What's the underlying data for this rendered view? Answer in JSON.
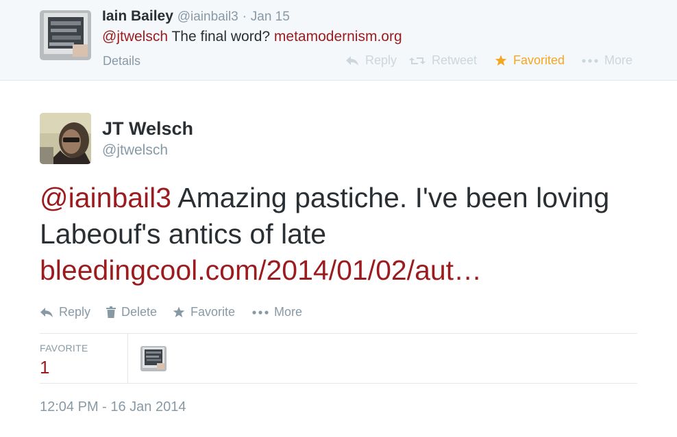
{
  "parent_tweet": {
    "name": "Iain Bailey",
    "handle": "@iainbail3",
    "separator": "·",
    "date": "Jan 15",
    "mention": "@jtwelsch",
    "text": "The final word?",
    "link": "metamodernism.org",
    "details_label": "Details",
    "actions": {
      "reply": "Reply",
      "retweet": "Retweet",
      "favorited": "Favorited",
      "more": "More"
    }
  },
  "tweet": {
    "author_name": "JT Welsch",
    "author_handle": "@jtwelsch",
    "mention": "@iainbail3",
    "text": "Amazing pastiche. I've been loving Labeouf's antics of late",
    "link": "bleedingcool.com/2014/01/02/aut…",
    "actions": {
      "reply": "Reply",
      "delete": "Delete",
      "favorite": "Favorite",
      "more": "More"
    },
    "stats": {
      "favorite_label": "FAVORITE",
      "favorite_count": "1"
    },
    "timestamp": "12:04 PM - 16 Jan 2014"
  },
  "colors": {
    "link": "#9b1b1e",
    "muted": "#8899a6",
    "faint": "#ccd6dd",
    "favorited": "#f5a623",
    "text": "#292f33"
  },
  "icons": [
    "reply-icon",
    "retweet-icon",
    "star-icon",
    "more-dots-icon",
    "trash-icon"
  ]
}
